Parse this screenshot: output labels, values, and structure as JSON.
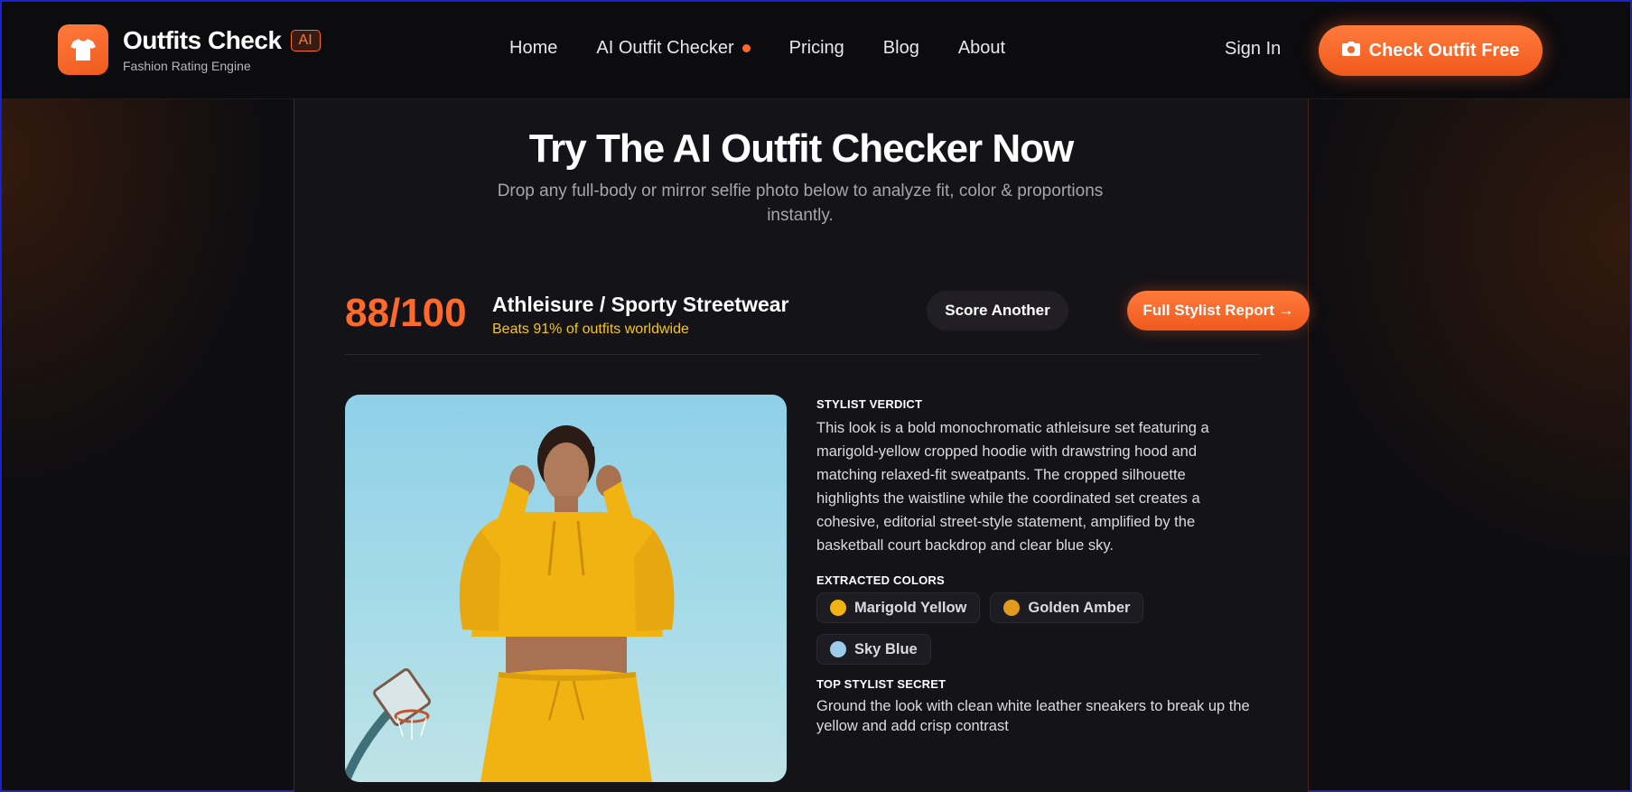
{
  "header": {
    "brand_title": "Outfits Check",
    "brand_badge": "AI",
    "brand_subtitle": "Fashion Rating Engine",
    "nav": [
      "Home",
      "AI Outfit Checker",
      "Pricing",
      "Blog",
      "About"
    ],
    "sign_in": "Sign In",
    "cta": "Check Outfit Free",
    "accent": "#ff6a2a"
  },
  "main": {
    "title": "Try The AI Outfit Checker Now",
    "subtitle": "Drop any full-body or mirror selfie photo below to analyze fit, color & proportions instantly.",
    "score": "88/100",
    "style_name": "Athleisure / Sporty Streetwear",
    "beats_text": "Beats 91% of outfits worldwide",
    "score_another": "Score Another",
    "full_report": "Full Stylist Report →",
    "verdict_heading": "STYLIST VERDICT",
    "verdict_text": "This look is a bold monochromatic athleisure set featuring a marigold-yellow cropped hoodie with drawstring hood and matching relaxed-fit sweatpants. The cropped silhouette highlights the waistline while the coordinated set creates a cohesive, editorial street-style statement, amplified by the basketball court backdrop and clear blue sky.",
    "colors_heading": "EXTRACTED COLORS",
    "colors": [
      {
        "name": "Marigold Yellow",
        "hex": "#f0b312"
      },
      {
        "name": "Golden Amber",
        "hex": "#e09a1c"
      },
      {
        "name": "Sky Blue",
        "hex": "#9ccbe8"
      }
    ],
    "secret_heading": "TOP STYLIST SECRET",
    "secret_text": "Ground the look with clean white leather sneakers to break up the yellow and add crisp contrast"
  }
}
